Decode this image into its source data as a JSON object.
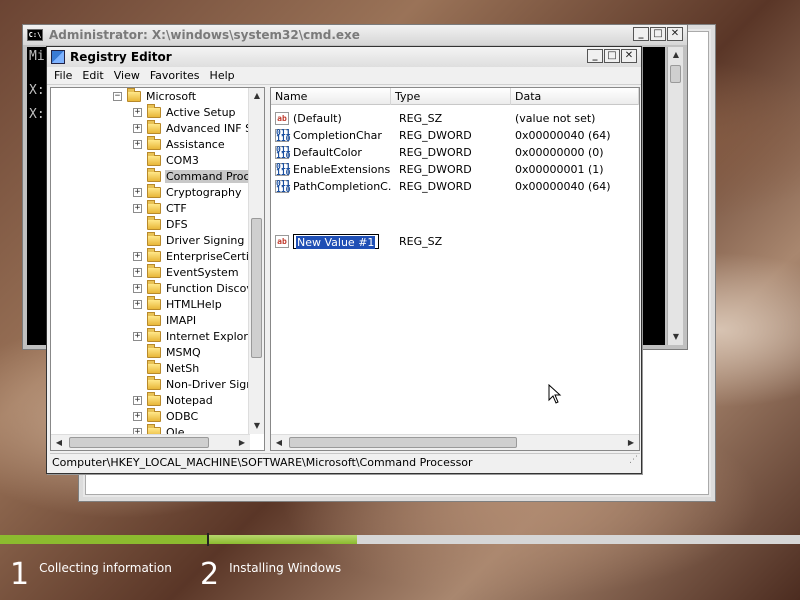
{
  "setup": {
    "steps": [
      {
        "number": "1",
        "label": "Collecting information",
        "done": true
      },
      {
        "number": "2",
        "label": "Installing Windows",
        "progress": 0.25
      }
    ]
  },
  "cmd": {
    "title": "Administrator: X:\\windows\\system32\\cmd.exe",
    "icon_text": "C:\\",
    "lines": [
      "Mi",
      "X:",
      "X:"
    ]
  },
  "regedit": {
    "title": "Registry Editor",
    "menu": [
      "File",
      "Edit",
      "View",
      "Favorites",
      "Help"
    ],
    "tree": {
      "parent": "Microsoft",
      "items": [
        {
          "label": "Active Setup",
          "expandable": true
        },
        {
          "label": "Advanced INF S",
          "expandable": true
        },
        {
          "label": "Assistance",
          "expandable": true
        },
        {
          "label": "COM3",
          "expandable": false
        },
        {
          "label": "Command Proce",
          "expandable": false,
          "selected": true
        },
        {
          "label": "Cryptography",
          "expandable": true
        },
        {
          "label": "CTF",
          "expandable": true
        },
        {
          "label": "DFS",
          "expandable": false
        },
        {
          "label": "Driver Signing",
          "expandable": false
        },
        {
          "label": "EnterpriseCertifi",
          "expandable": true
        },
        {
          "label": "EventSystem",
          "expandable": true
        },
        {
          "label": "Function Discove",
          "expandable": true
        },
        {
          "label": "HTMLHelp",
          "expandable": true
        },
        {
          "label": "IMAPI",
          "expandable": false
        },
        {
          "label": "Internet Explore",
          "expandable": true
        },
        {
          "label": "MSMQ",
          "expandable": false
        },
        {
          "label": "NetSh",
          "expandable": false
        },
        {
          "label": "Non-Driver Signi",
          "expandable": false
        },
        {
          "label": "Notepad",
          "expandable": true
        },
        {
          "label": "ODBC",
          "expandable": true
        },
        {
          "label": "Ole",
          "expandable": true
        }
      ]
    },
    "columns": [
      "Name",
      "Type",
      "Data"
    ],
    "values": [
      {
        "name": "(Default)",
        "type": "REG_SZ",
        "data": "(value not set)",
        "kind": "sz"
      },
      {
        "name": "CompletionChar",
        "type": "REG_DWORD",
        "data": "0x00000040 (64)",
        "kind": "dw"
      },
      {
        "name": "DefaultColor",
        "type": "REG_DWORD",
        "data": "0x00000000 (0)",
        "kind": "dw"
      },
      {
        "name": "EnableExtensions",
        "type": "REG_DWORD",
        "data": "0x00000001 (1)",
        "kind": "dw"
      },
      {
        "name": "PathCompletionC...",
        "type": "REG_DWORD",
        "data": "0x00000040 (64)",
        "kind": "dw"
      }
    ],
    "new_value": {
      "name": "New Value #1",
      "type": "REG_SZ"
    },
    "icons": {
      "sz": "ab",
      "dw": "011\n110"
    },
    "status": "Computer\\HKEY_LOCAL_MACHINE\\SOFTWARE\\Microsoft\\Command Processor"
  },
  "colors": {
    "progress": "#8cbb2f",
    "selection": "#1f4fb5"
  }
}
